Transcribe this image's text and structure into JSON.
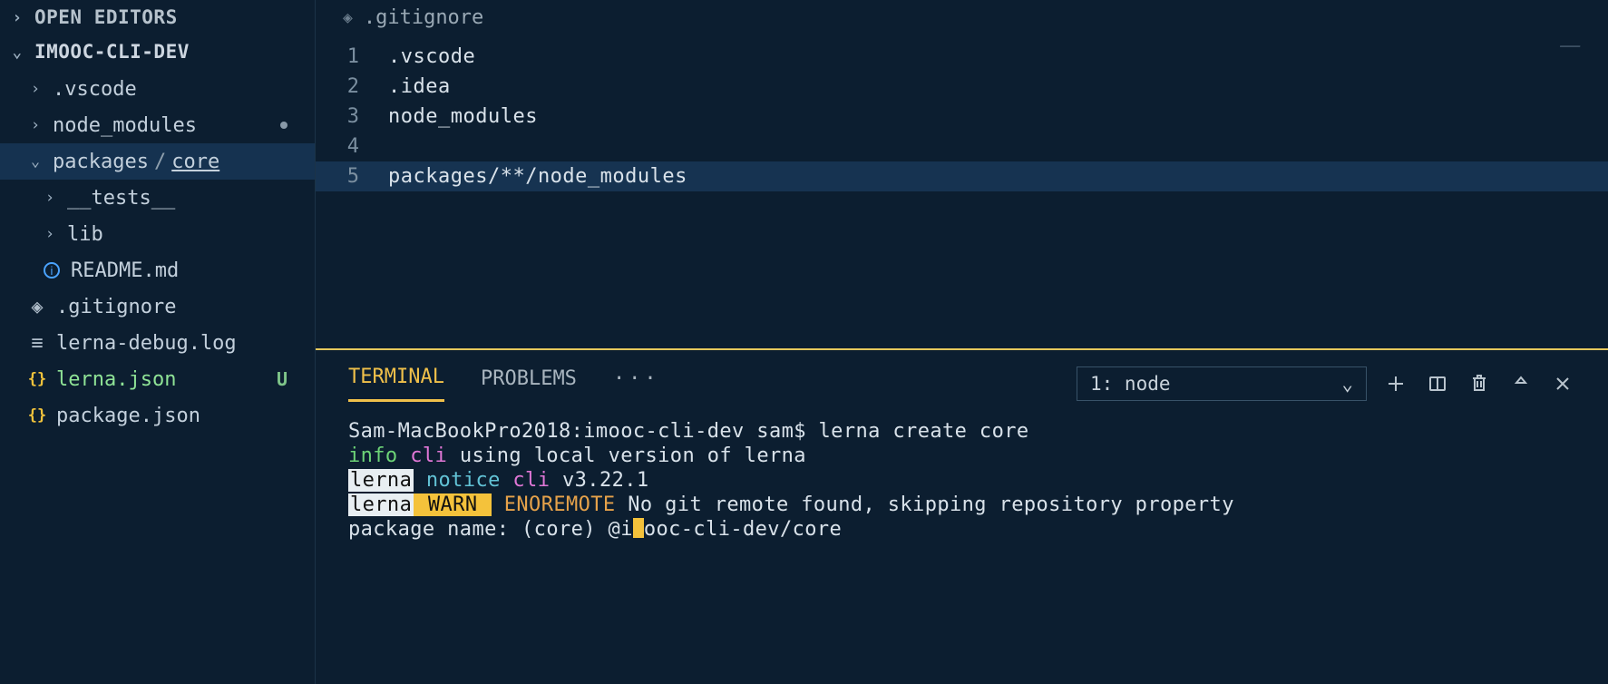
{
  "explorer": {
    "open_editors_label": "OPEN EDITORS",
    "project_label": "IMOOC-CLI-DEV",
    "items": {
      "vscode": ".vscode",
      "node_modules": "node_modules",
      "packages": "packages",
      "core": "core",
      "tests": "__tests__",
      "lib": "lib",
      "readme": "README.md",
      "gitignore": ".gitignore",
      "lerna_debug": "lerna-debug.log",
      "lerna_json": "lerna.json",
      "lerna_json_status": "U",
      "package_json": "package.json"
    },
    "path_sep": "/"
  },
  "tabs": {
    "active": ".gitignore"
  },
  "editor": {
    "lines": [
      {
        "n": "1",
        "t": ".vscode"
      },
      {
        "n": "2",
        "t": ".idea"
      },
      {
        "n": "3",
        "t": "node_modules"
      },
      {
        "n": "4",
        "t": ""
      },
      {
        "n": "5",
        "t": "packages/**/node_modules"
      }
    ]
  },
  "panel": {
    "tabs": {
      "terminal": "TERMINAL",
      "problems": "PROBLEMS",
      "more": "···"
    },
    "dropdown_label": "1: node",
    "terminal": {
      "line1_host": "Sam-MacBookPro2018:",
      "line1_path": "imooc-cli-dev sam$ ",
      "line1_cmd": "lerna create core",
      "line2_info": "info",
      "line2_cli": " cli",
      "line2_rest": " using local version of lerna",
      "line3_lerna": "lerna",
      "line3_notice": " notice",
      "line3_cli": " cli",
      "line3_ver": " v3.22.1",
      "line4_lerna": "lerna",
      "line4_warn": " WARN ",
      "line4_enoremote": "ENOREMOTE",
      "line4_rest": " No git remote found, skipping repository property",
      "line5_prompt": "package name: (core) @i",
      "line5_after": "ooc-cli-dev/core"
    }
  }
}
